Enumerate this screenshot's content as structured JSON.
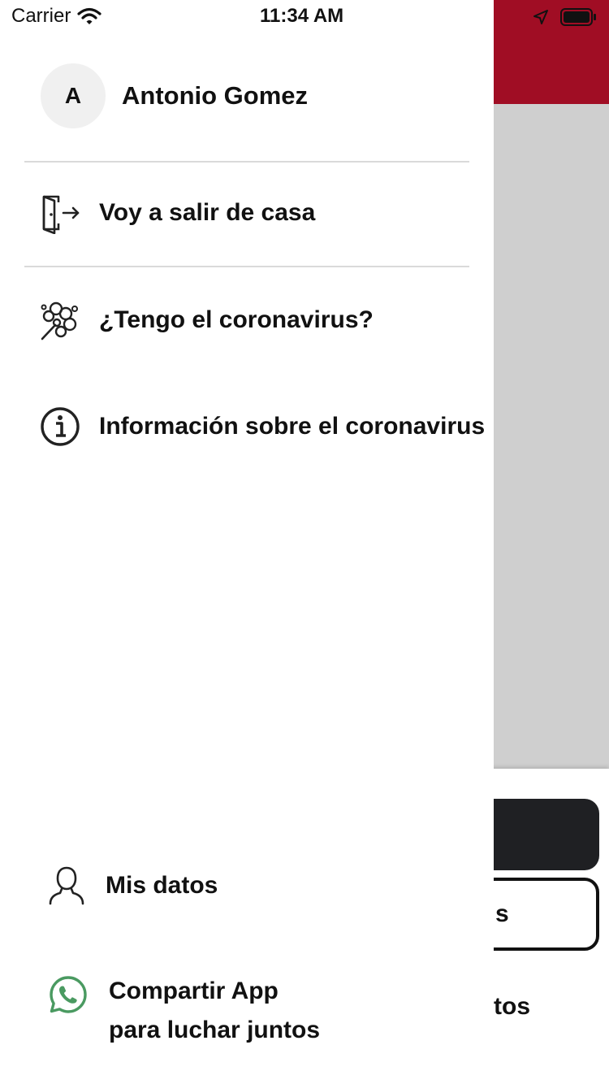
{
  "status_bar": {
    "carrier": "Carrier",
    "time": "11:34 AM"
  },
  "profile": {
    "initial": "A",
    "name": "Antonio Gomez"
  },
  "menu": {
    "leave_home": "Voy a salir de casa",
    "symptoms": "¿Tengo el coronavirus?",
    "info": "Información sobre el coronavirus",
    "my_data": "Mis datos",
    "share_line1": "Compartir App",
    "share_line2": "para luchar juntos"
  },
  "background": {
    "outline_button_fragment": "s",
    "link_fragment": "tos"
  },
  "colors": {
    "header_red": "#a00d24",
    "whatsapp_green": "#4a9a61",
    "dark_button": "#1f2023"
  },
  "icons": {
    "leave_home": "door-exit-icon",
    "symptoms": "virus-icon",
    "info": "info-icon",
    "my_data": "user-icon",
    "share": "whatsapp-icon"
  }
}
